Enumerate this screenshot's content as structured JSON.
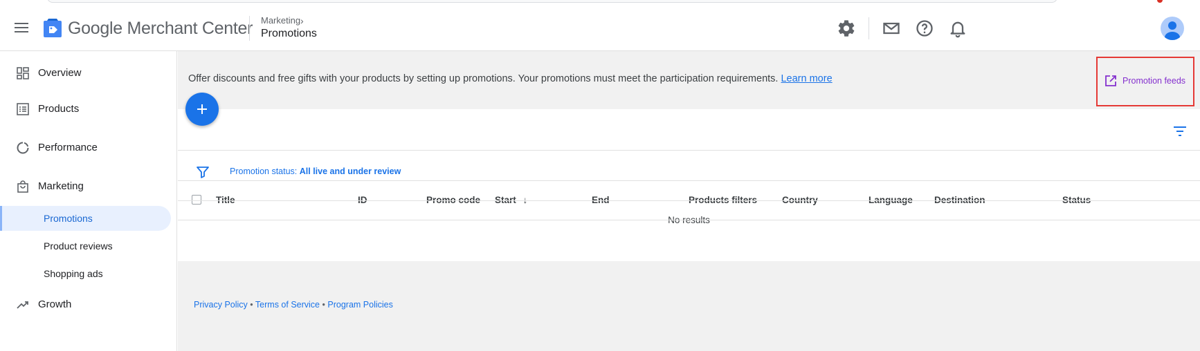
{
  "header": {
    "logo_text": "Google Merchant Center",
    "breadcrumb_parent": "Marketing",
    "breadcrumb_chevron": "›",
    "breadcrumb_current": "Promotions",
    "icons": [
      "gear-icon",
      "mail-icon",
      "help-icon",
      "bell-icon"
    ]
  },
  "sidebar": {
    "items": [
      {
        "label": "Overview",
        "icon": "dashboard-icon"
      },
      {
        "label": "Products",
        "icon": "list-icon"
      },
      {
        "label": "Performance",
        "icon": "donut-icon"
      },
      {
        "label": "Marketing",
        "icon": "shopping-bag-icon"
      },
      {
        "label": "Growth",
        "icon": "trending-up-icon"
      }
    ],
    "marketing_sub": [
      {
        "label": "Promotions",
        "active": true
      },
      {
        "label": "Product reviews",
        "active": false
      },
      {
        "label": "Shopping ads",
        "active": false
      }
    ]
  },
  "banner": {
    "text": "Offer discounts and free gifts with your products by setting up promotions. Your promotions must meet the participation requirements.",
    "link": "Learn more",
    "promotion_feeds": "Promotion feeds"
  },
  "filter": {
    "label": "Promotion status:",
    "value": "All live and under review"
  },
  "table": {
    "columns": [
      "Title",
      "ID",
      "Promo code",
      "Start",
      "End",
      "Products filters",
      "Country",
      "Language",
      "Destination",
      "Status"
    ],
    "sort_indicator": "↓",
    "empty_text": "No results"
  },
  "footer": {
    "links": [
      "Privacy Policy",
      "Terms of Service",
      "Program Policies"
    ],
    "separator": "•"
  },
  "colors": {
    "accent": "#1a73e8",
    "promo_feeds_text": "#8430ce",
    "highlight_box": "#e53935",
    "active_nav_bg": "#e8f0fe"
  }
}
